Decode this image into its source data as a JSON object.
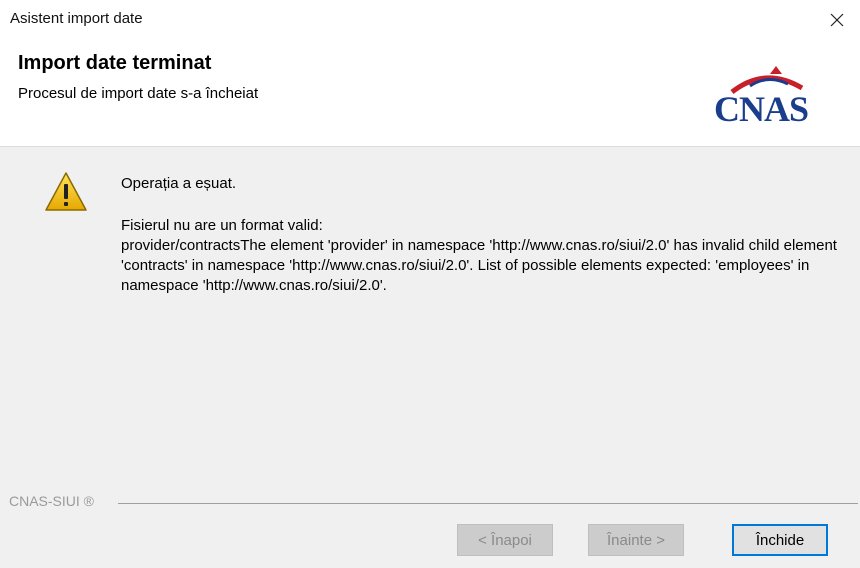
{
  "window": {
    "title": "Asistent import date",
    "close_icon": "close-icon"
  },
  "header": {
    "title": "Import date terminat",
    "subtitle": "Procesul de import date s-a încheiat",
    "logo_text": "CNAS",
    "logo_colors": {
      "arc": "#c8202a",
      "text": "#1a3e8c"
    }
  },
  "message": {
    "icon": "warning-icon",
    "title": "Operația a eșuat.",
    "body": "Fisierul nu are un format valid:\nprovider/contractsThe element 'provider' in namespace 'http://www.cnas.ro/siui/2.0' has invalid child element 'contracts' in namespace 'http://www.cnas.ro/siui/2.0'. List of possible elements expected: 'employees' in namespace 'http://www.cnas.ro/siui/2.0'."
  },
  "footer": {
    "brand": "CNAS-SIUI ®"
  },
  "buttons": {
    "back": "< Înapoi",
    "next": "Înainte >",
    "close": "Închide"
  },
  "colors": {
    "content_bg": "#f0f0f0",
    "primary_border": "#0078d7",
    "warning_yellow": "#f5c400"
  }
}
